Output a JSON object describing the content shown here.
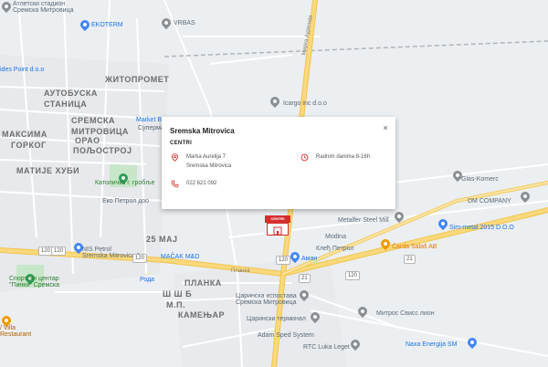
{
  "map": {
    "districts": [
      "АУТОБУСКА",
      "СТАНИЦА",
      "МАКСИМА",
      "ГОРКОГ",
      "МАТИЈЕ ХУБИ",
      "ЖИТОПРОМЕТ",
      "СРЕМСКА",
      "МИТРОВИЦА",
      "ОРАО",
      "ПОЉОСТРОЈ",
      "25 МАЈ",
      "ПЛАНКА",
      "Ш Ш Б",
      "М.П.",
      "КАМЕЊАР"
    ],
    "pois": {
      "stadium": "Атлетски стадион\nСремска Митровица",
      "ekoterm": "EKOTERM",
      "vrbas": "VRBAS",
      "ides_point": "ides Point d.o.o",
      "market": "Market B",
      "market2": "Супермар",
      "icargo": "Icargo inc d.o.o",
      "catholic": "Католичко г. гробље",
      "eko_petrol": "Еко Петрол доо",
      "glas_komerc": "Glas-Komerc",
      "dm_company": "DM COMPANY",
      "metalfer": "Metalfer Steel Mill",
      "sim_metal": "Sim-metal 2015 D.O.O",
      "modina": "Modina",
      "carda": "Čarda Salaš AB",
      "kles_petrol": "Клеђ Петрол",
      "aman": "Аман",
      "nis": "NIS Petrol\nSremska Mitrovica 1",
      "macak": "МАČAK M&D",
      "roda": "Рода",
      "sports_center": "Спортски центар\n\"Пинки\" Сремска",
      "villa": "/ Villa\nRestaurant",
      "postal": "Царинска испостава\nСремска Митровица",
      "customs_terminal": "Царински терминал",
      "mitros": "Митрос Свисс лион",
      "adam": "Adam Sped System",
      "rtc": "RTC Luka Leget",
      "naxa": "Naxa Energija SM"
    },
    "roads": {
      "planka": "Планка",
      "marka_aurelija": "Марка Аурелија",
      "shield_120a": "120",
      "shield_120b": "120",
      "shield_120c": "120",
      "shield_120d": "120",
      "shield_120e": "120",
      "shield_21": "21",
      "shield_21b": "21"
    },
    "colors": {
      "road_major": "#f9d97c",
      "road_major_stroke": "#f1c44e",
      "park": "#c8e6c9",
      "water": "#aadaff",
      "background": "#eceff1",
      "road_minor": "#ffffff"
    }
  },
  "info_card": {
    "title": "Sremska Mitrovica",
    "close": "×",
    "category": "CENTRI",
    "address_line1": "Marka Aurelija 7",
    "address_line2": "Sremska Mitrovica",
    "hours": "Radnim danima 8-16h",
    "phone": "022 621 092",
    "icons": {
      "address": "location-pin-icon",
      "hours": "clock-icon",
      "phone": "phone-icon"
    },
    "accent": "#d32f2f"
  },
  "marker": {
    "label": "CENTRI"
  }
}
